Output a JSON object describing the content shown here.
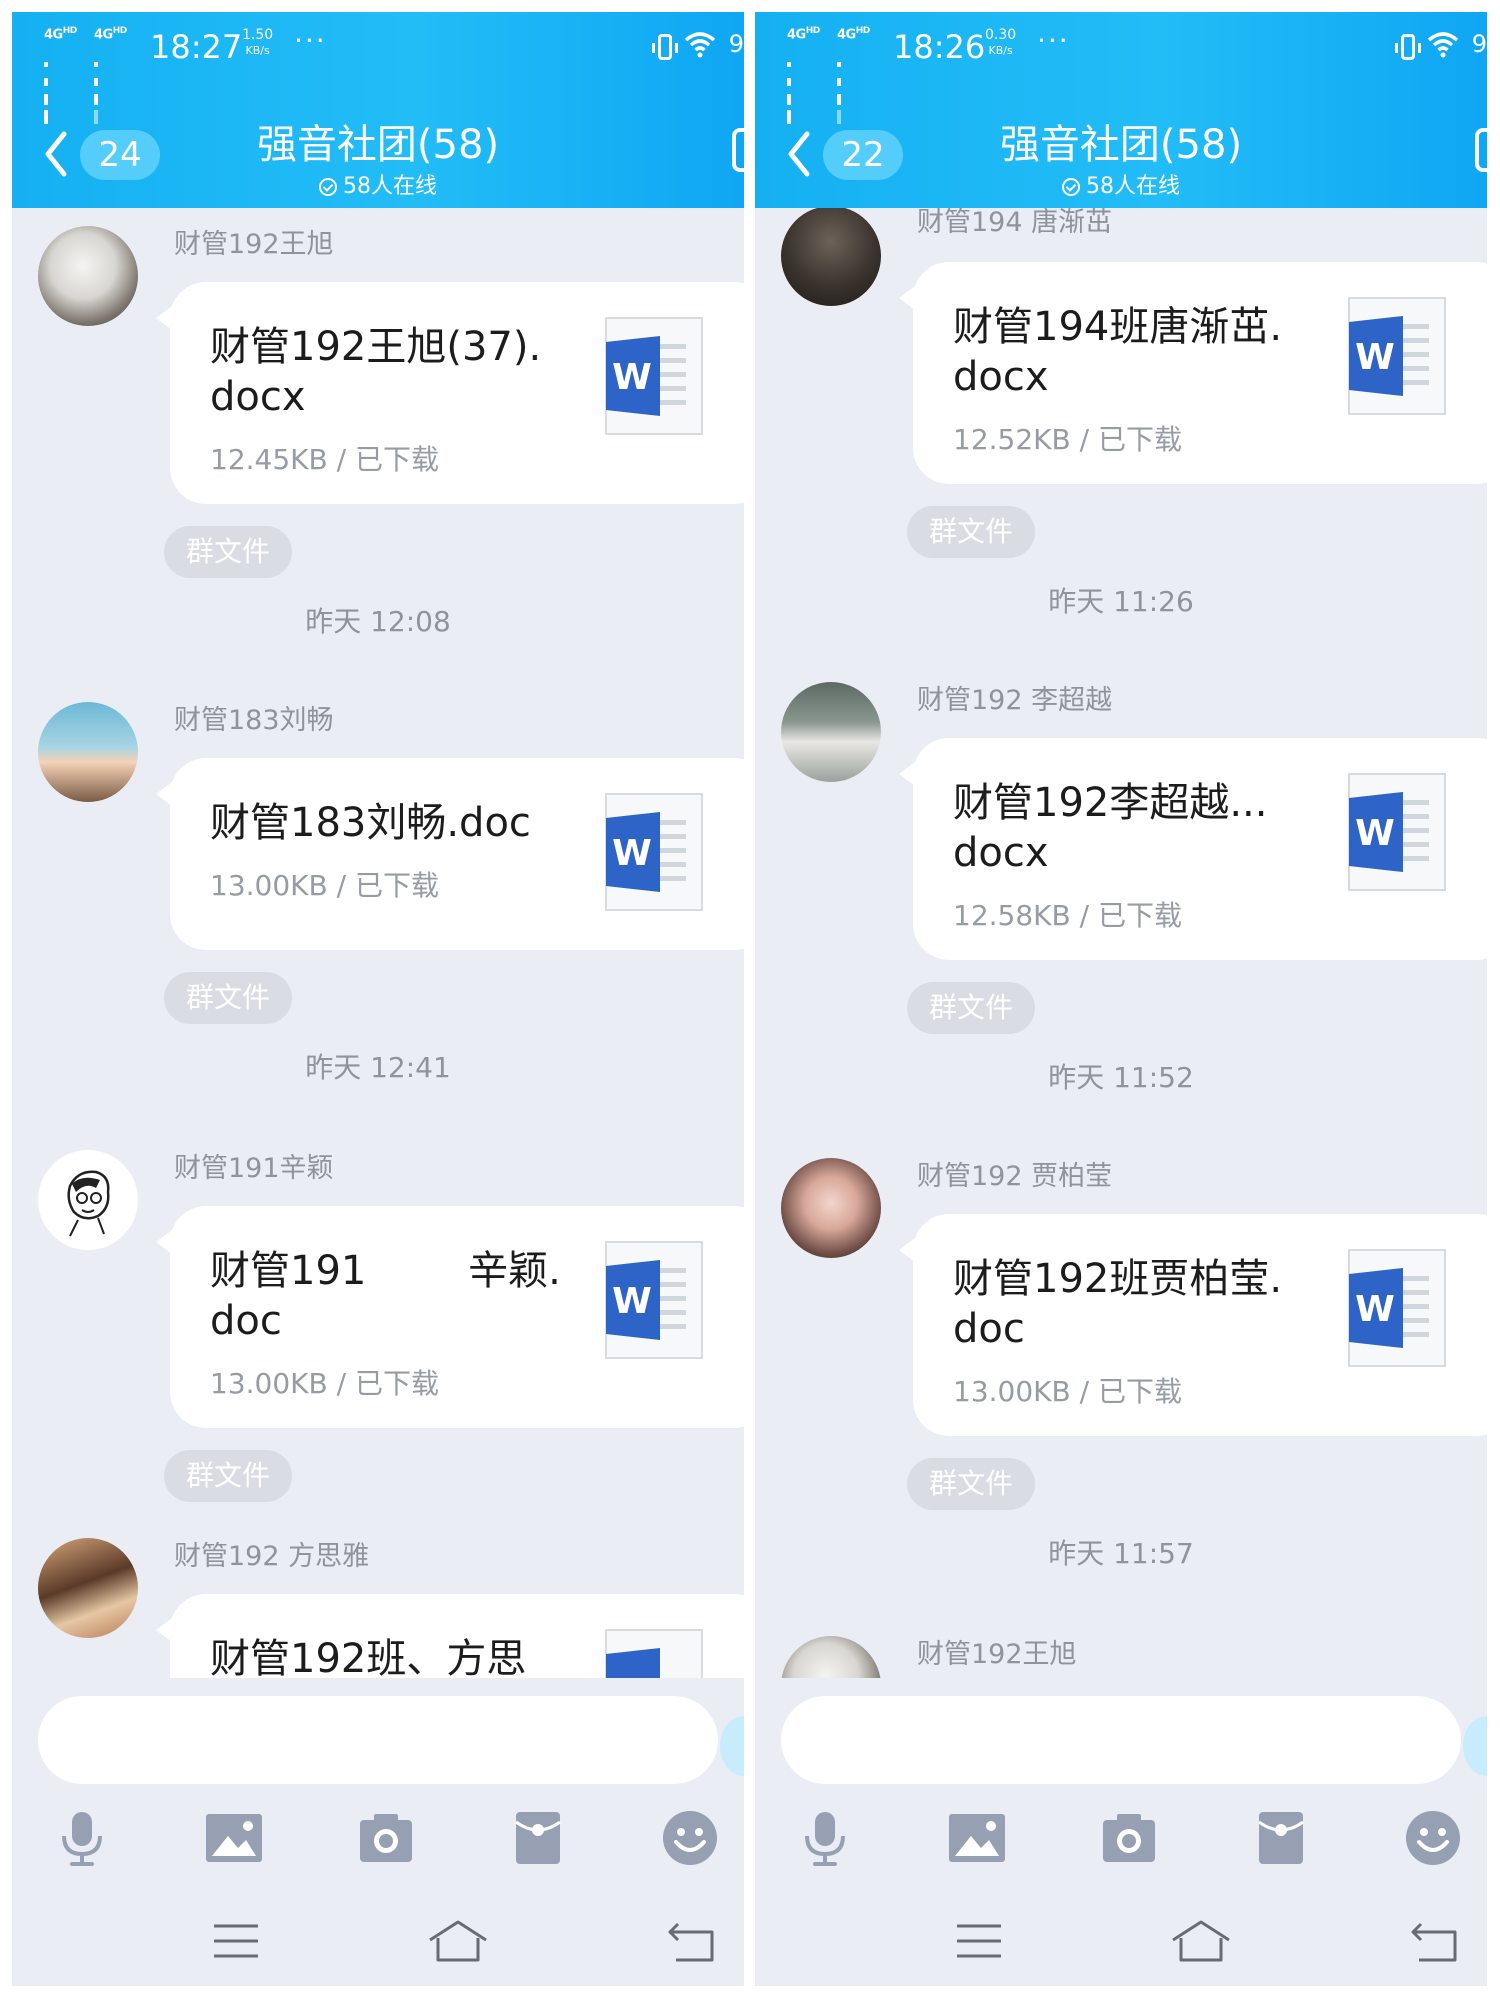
{
  "screens": [
    {
      "status": {
        "network1": "4G",
        "hd1": "HD",
        "network2": "4G",
        "hd2": "HD",
        "time": "18:27",
        "rate_value": "1.50",
        "rate_unit": "KB/s",
        "more": "···",
        "battery": "9"
      },
      "header": {
        "unread_badge": "24",
        "title": "强音社团(58)",
        "online": "58人在线"
      },
      "messages": [
        {
          "sender": "财管192王旭",
          "file_name": "财管192王旭(37).\ndocx",
          "file_meta": "12.45KB / 已下载",
          "chip": "群文件"
        },
        {
          "time": "昨天 12:08",
          "sender": "财管183刘畅",
          "file_name": "财管183刘畅.doc",
          "file_meta": "13.00KB / 已下载",
          "chip": "群文件"
        },
        {
          "time": "昨天 12:41",
          "sender": "财管191辛颖",
          "file_name": "财管191        辛颖.\ndoc",
          "file_meta": "13.00KB / 已下载",
          "chip": "群文件"
        },
        {
          "sender": "财管192 方思雅",
          "file_name": "财管192班、方思"
        }
      ]
    },
    {
      "status": {
        "network1": "4G",
        "hd1": "HD",
        "network2": "4G",
        "hd2": "HD",
        "time": "18:26",
        "rate_value": "0.30",
        "rate_unit": "KB/s",
        "more": "···",
        "battery": "9"
      },
      "header": {
        "unread_badge": "22",
        "title": "强音社团(58)",
        "online": "58人在线"
      },
      "messages": [
        {
          "sender": "财管194 唐渐茁",
          "file_name": "财管194班唐渐茁.\ndocx",
          "file_meta": "12.52KB / 已下载",
          "chip": "群文件"
        },
        {
          "time": "昨天 11:26",
          "sender": "财管192 李超越",
          "file_name": "财管192李超越...\ndocx",
          "file_meta": "12.58KB / 已下载",
          "chip": "群文件"
        },
        {
          "time": "昨天 11:52",
          "sender": "财管192  贾柏莹",
          "file_name": "财管192班贾柏莹.\ndoc",
          "file_meta": "13.00KB / 已下载",
          "chip": "群文件"
        },
        {
          "time": "昨天 11:57",
          "sender": "财管192王旭"
        }
      ]
    }
  ],
  "colors": {
    "header": "#1fb8f5",
    "background": "#eaedf4",
    "bubble": "#ffffff",
    "word_blue": "#2e63c7"
  },
  "toolbar_icons": [
    "microphone-icon",
    "image-icon",
    "camera-icon",
    "red-packet-icon",
    "emoji-icon"
  ],
  "nav_icons": [
    "menu-icon",
    "home-icon",
    "back-icon"
  ]
}
